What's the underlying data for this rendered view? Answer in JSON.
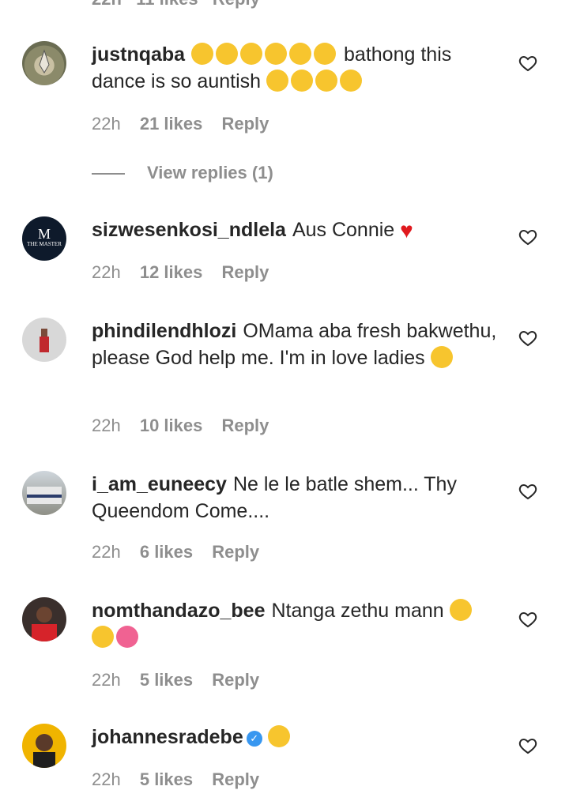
{
  "top_partial": {
    "time": "22h",
    "likes": "11 likes",
    "reply": "Reply"
  },
  "comments": [
    {
      "username": "justnqaba",
      "text_before": "",
      "text": " bathong this dance is so auntish ",
      "time": "22h",
      "likes": "21 likes",
      "reply": "Reply",
      "view_replies": "View replies (1)"
    },
    {
      "username": "sizwesenkosi_ndlela",
      "text": "Aus Connie",
      "time": "22h",
      "likes": "12 likes",
      "reply": "Reply",
      "avatar_text": "THE MASTER"
    },
    {
      "username": "phindilendhlozi",
      "text": "OMama aba fresh bakwethu, please God help me. I'm in love ladies",
      "time": "22h",
      "likes": "10 likes",
      "reply": "Reply"
    },
    {
      "username": "i_am_euneecy",
      "text": "Ne le le batle shem... Thy Queendom Come....",
      "time": "22h",
      "likes": "6 likes",
      "reply": "Reply"
    },
    {
      "username": "nomthandazo_bee",
      "text": "Ntanga zethu mann",
      "time": "22h",
      "likes": "5 likes",
      "reply": "Reply"
    },
    {
      "username": "johannesradebe",
      "text": "",
      "time": "22h",
      "likes": "5 likes",
      "reply": "Reply"
    }
  ],
  "icons": {
    "like": "heart-outline-icon",
    "verified": "verified-badge-icon"
  },
  "colors": {
    "text": "#262626",
    "meta": "#8e8e8e",
    "verified": "#3897f0",
    "emoji": "#f7c52e"
  }
}
